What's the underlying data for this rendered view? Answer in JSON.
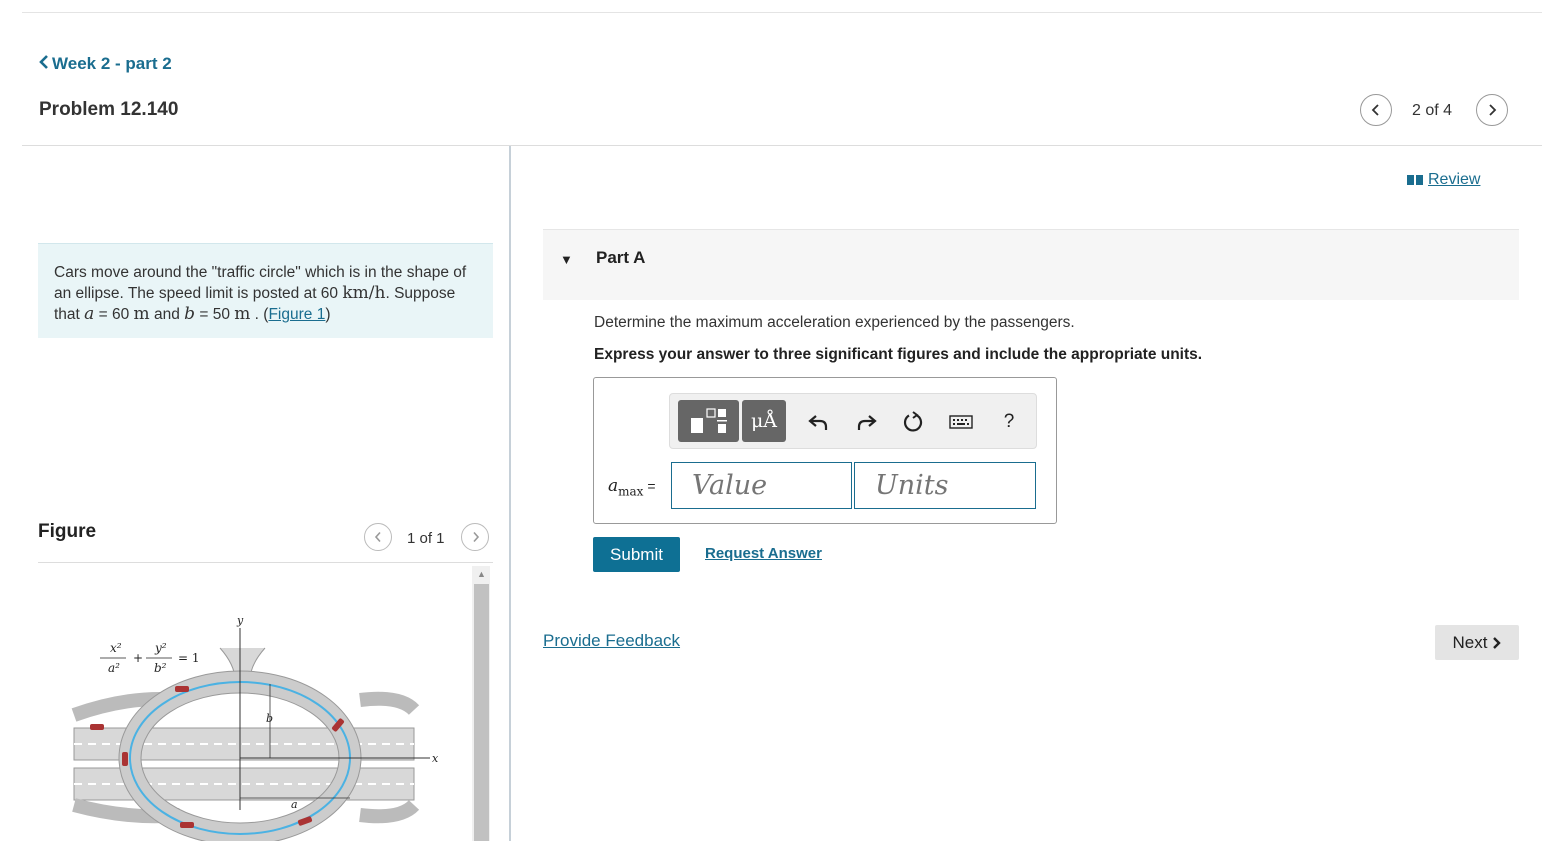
{
  "header": {
    "back_label": "Week 2 - part 2",
    "problem_title": "Problem 12.140",
    "pager_text": "2 of 4"
  },
  "problem": {
    "text1": "Cars move around the \"traffic circle\" which is in the shape of an ellipse. The speed limit is posted at 60",
    "speed_unit": "km/h",
    "text2": ". Suppose that",
    "a_var": "a",
    "a_eq": " = 60 ",
    "a_unit": "m",
    "and_text": " and ",
    "b_var": "b",
    "b_eq": " = 50 ",
    "b_unit": "m",
    "period_text": " . (",
    "figure_link": "Figure 1",
    "close_paren": ")"
  },
  "figure": {
    "label": "Figure",
    "pager_text": "1 of 1",
    "eq_x2": "x²",
    "eq_a2": "a²",
    "eq_plus": "+",
    "eq_y2": "y²",
    "eq_b2": "b²",
    "eq_rhs": "= 1",
    "axis_y": "y",
    "axis_x": "x",
    "dim_b": "b",
    "dim_a": "a"
  },
  "review_label": "Review",
  "part_a": {
    "title": "Part A",
    "question": "Determine the maximum acceleration experienced by the passengers.",
    "instruction": "Express your answer to three significant figures and include the appropriate units.",
    "var_main": "a",
    "var_sub": "max",
    "equals": " =",
    "value_placeholder": "Value",
    "units_placeholder": "Units",
    "tool_units_label": "μÅ",
    "tool_help": "?",
    "submit_label": "Submit",
    "request_label": "Request Answer"
  },
  "feedback_label": "Provide Feedback",
  "next_label": "Next",
  "colors": {
    "accent": "#1a6d8f",
    "submit_bg": "#0e7094",
    "problem_bg": "#e9f5f7",
    "ellipse_blue": "#4bb2e3"
  },
  "icons": [
    "chevron-left-icon",
    "chevron-right-icon",
    "review-book-icon",
    "templates-icon",
    "undo-icon",
    "redo-icon",
    "reset-icon",
    "keyboard-icon",
    "collapse-triangle-icon"
  ]
}
